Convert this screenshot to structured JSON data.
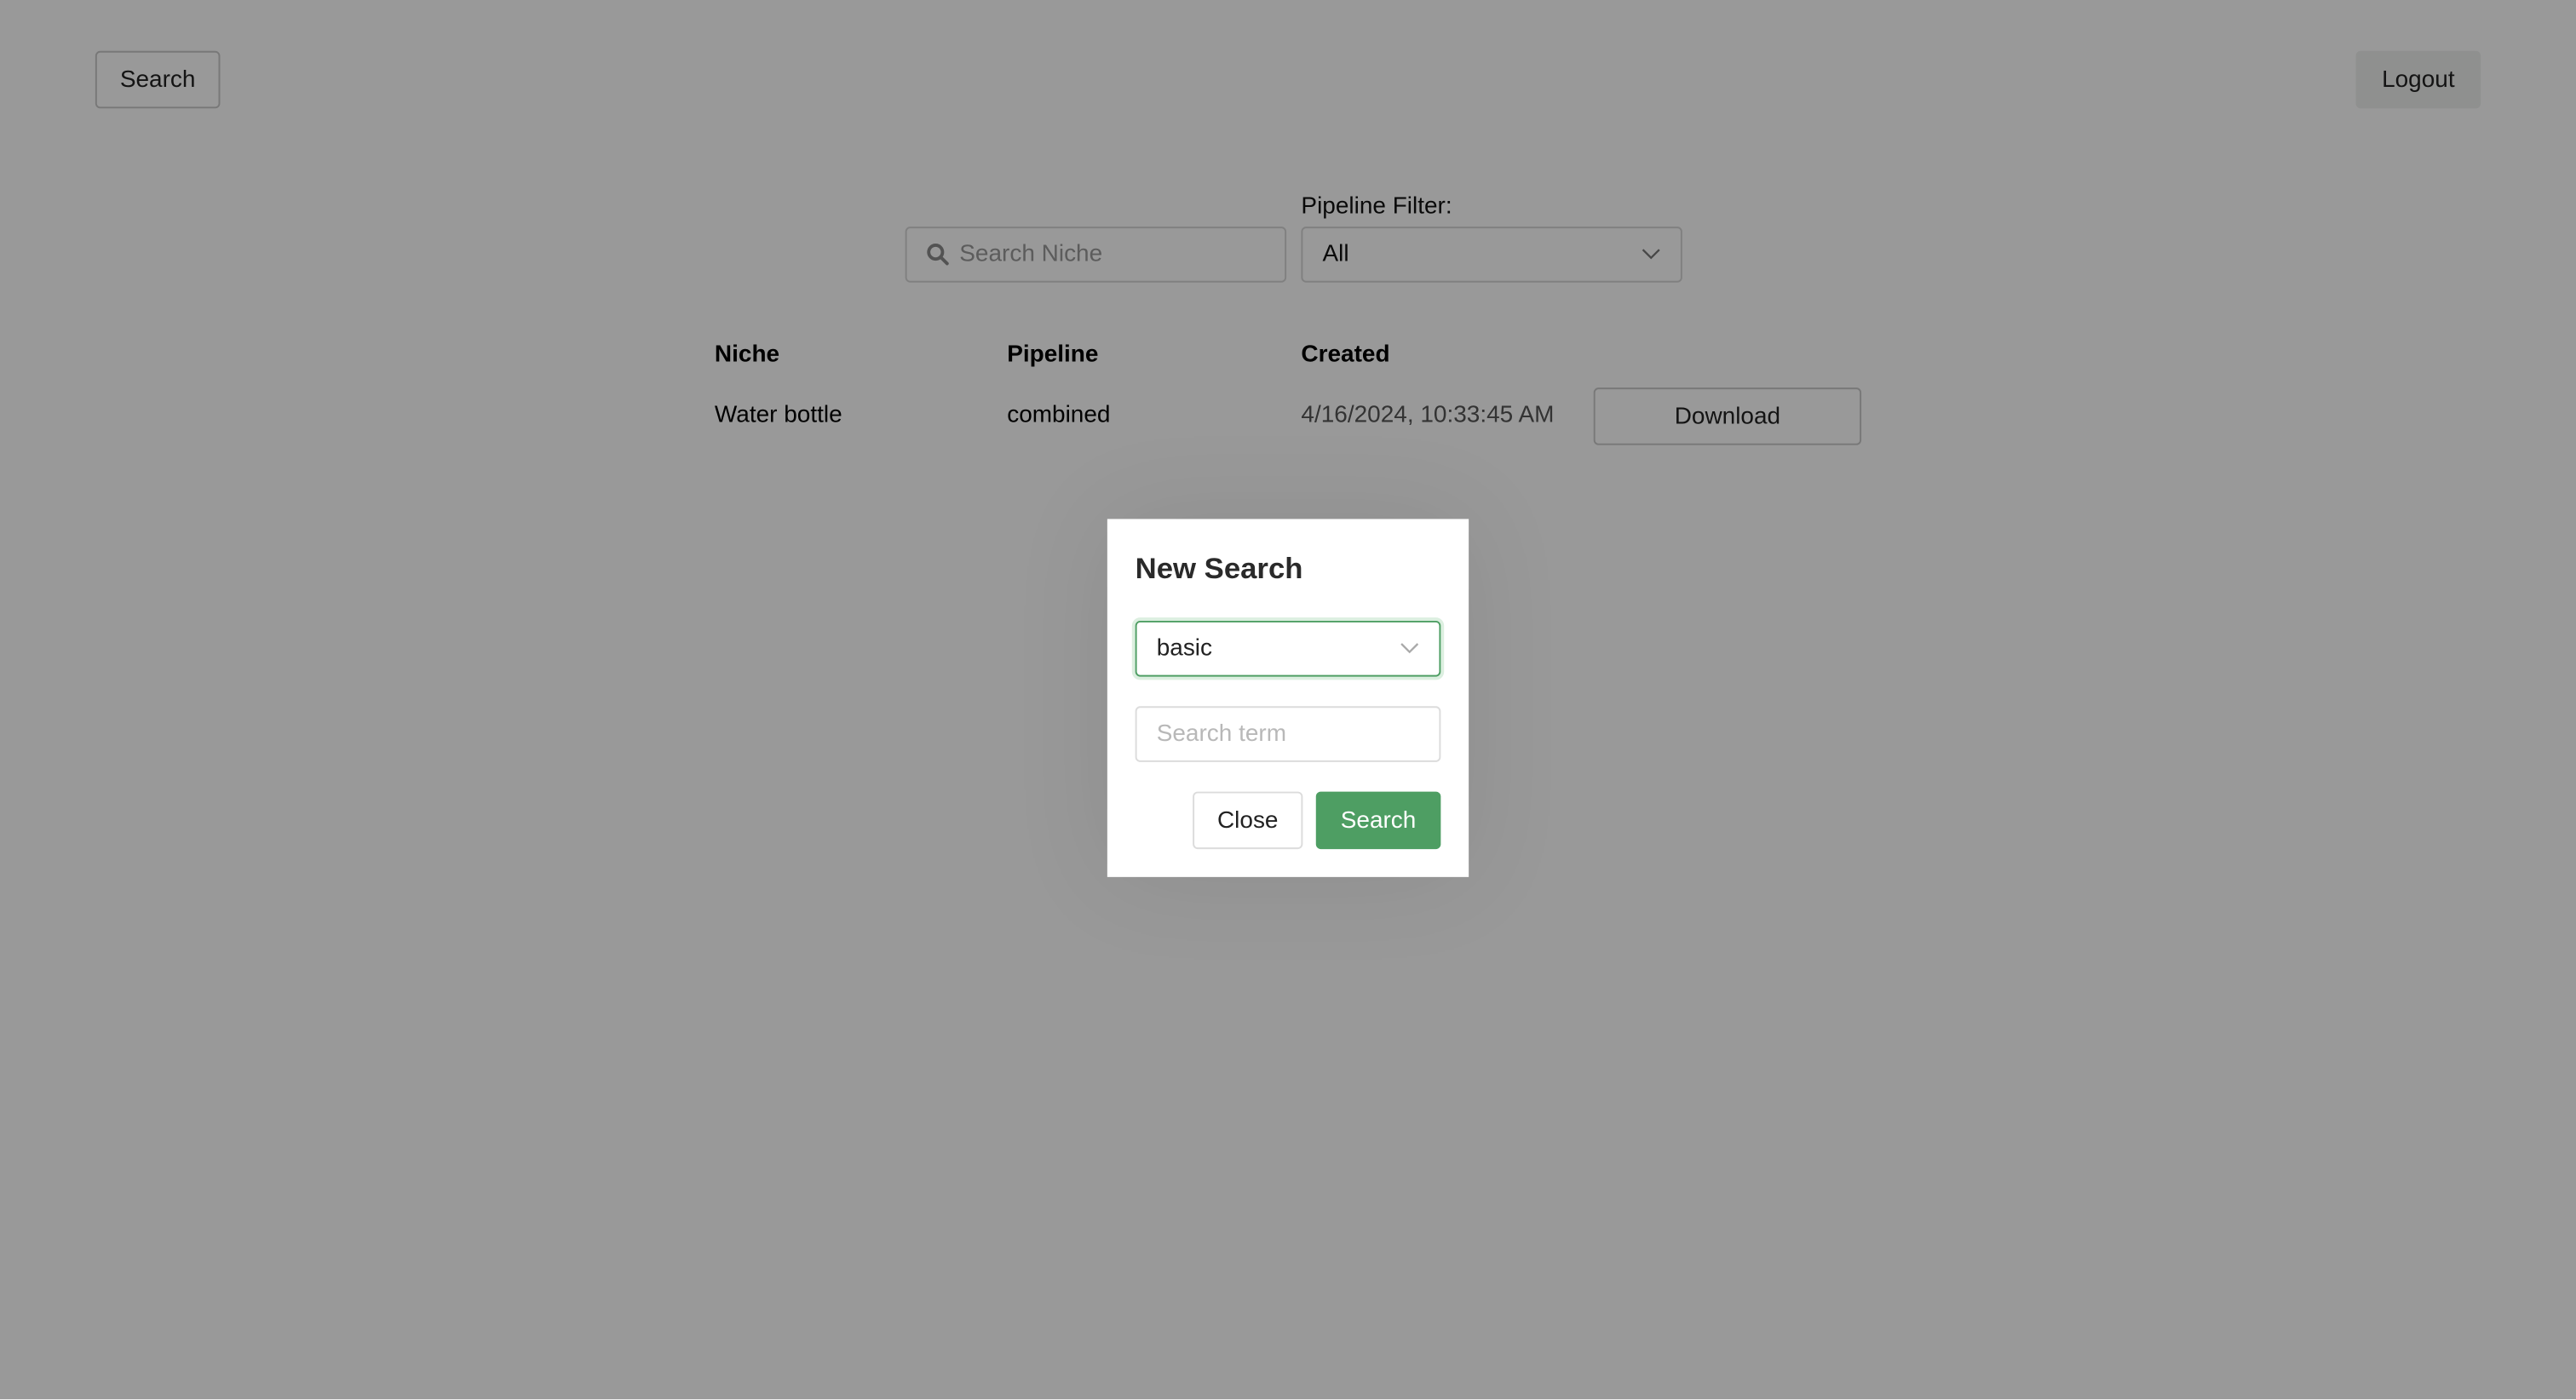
{
  "header": {
    "search_button": "Search",
    "logout_button": "Logout"
  },
  "filters": {
    "niche_search_placeholder": "Search Niche",
    "pipeline_filter_label": "Pipeline Filter:",
    "pipeline_filter_value": "All"
  },
  "table": {
    "columns": [
      "Niche",
      "Pipeline",
      "Created"
    ],
    "rows": [
      {
        "niche": "Water bottle",
        "pipeline": "combined",
        "created": "4/16/2024, 10:33:45 AM",
        "action": "Download"
      }
    ]
  },
  "modal": {
    "title": "New Search",
    "type_select_value": "basic",
    "term_placeholder": "Search term",
    "close_button": "Close",
    "search_button": "Search",
    "accent_color": "#4e9e63"
  },
  "icons": {
    "search": "search-icon",
    "chevron": "chevron-down-icon"
  }
}
